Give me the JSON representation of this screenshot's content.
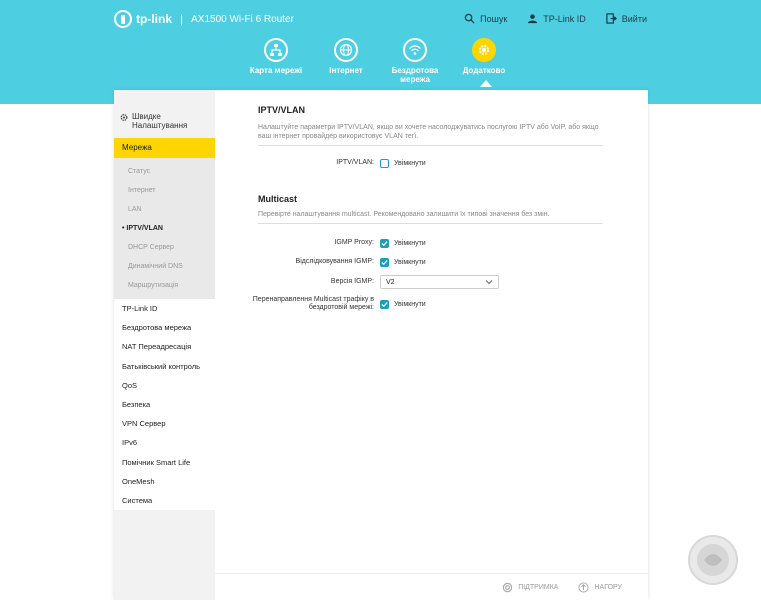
{
  "header": {
    "brand": "tp-link",
    "separator": "|",
    "model": "AX1500 Wi-Fi 6 Router",
    "links": [
      {
        "label": "Пошук",
        "icon": "search-icon"
      },
      {
        "label": "TP-Link ID",
        "icon": "user-icon"
      },
      {
        "label": "Вийти",
        "icon": "logout-icon"
      }
    ],
    "tabs": [
      {
        "label": "Карта мережі",
        "icon": "network-map-icon"
      },
      {
        "label": "Інтернет",
        "icon": "globe-icon"
      },
      {
        "label": "Бездротова мережа",
        "icon": "wifi-icon"
      },
      {
        "label": "Додатково",
        "icon": "gear-icon",
        "active": true
      }
    ]
  },
  "sidebar": {
    "quick_setup": "Швидке Налаштування",
    "active": "Мережа",
    "sub_items": [
      "Статус",
      "Інтернет",
      "LAN",
      "IPTV/VLAN",
      "DHCP Сервер",
      "Динамічний DNS",
      "Маршрутизація"
    ],
    "current_sub": "IPTV/VLAN",
    "items": [
      "TP-Link ID",
      "Бездротова мережа",
      "NAT Переадресація",
      "Батьківський контроль",
      "QoS",
      "Безпека",
      "VPN Сервер",
      "IPv6",
      "Помічник Smart Life",
      "OneMesh",
      "Система"
    ]
  },
  "iptv": {
    "title": "IPTV/VLAN",
    "description": "Налаштуйте параметри IPTV/VLAN, якщо ви хочете насолоджуватись послугою IPTV або VoIP, або якщо ваш інтернет провайдер використовує VLAN теґі.",
    "label": "IPTV/VLAN:",
    "option": "Увімкнути",
    "checked": false
  },
  "multicast": {
    "title": "Multicast",
    "description": "Перевірте налаштування multicast. Рекомендовано залишити їх типові значення без змін.",
    "igmp_proxy": {
      "label": "IGMP Proxy:",
      "option": "Увімкнути",
      "checked": true
    },
    "igmp_snooping": {
      "label": "Відслідковування IGMP:",
      "option": "Увімкнути",
      "checked": true
    },
    "igmp_version": {
      "label": "Версія IGMP:",
      "value": "V2"
    },
    "wireless_multicast": {
      "label": "Перенаправлення Multicast трафіку в бездротовій мережі:",
      "option": "Увімкнути",
      "checked": true
    }
  },
  "footer": {
    "support": "ПІДТРИМКА",
    "top": "НАГОРУ"
  },
  "colors": {
    "header_bg": "#4ecfe1",
    "accent_yellow": "#ffd500",
    "checkbox": "#1a9fb8"
  }
}
